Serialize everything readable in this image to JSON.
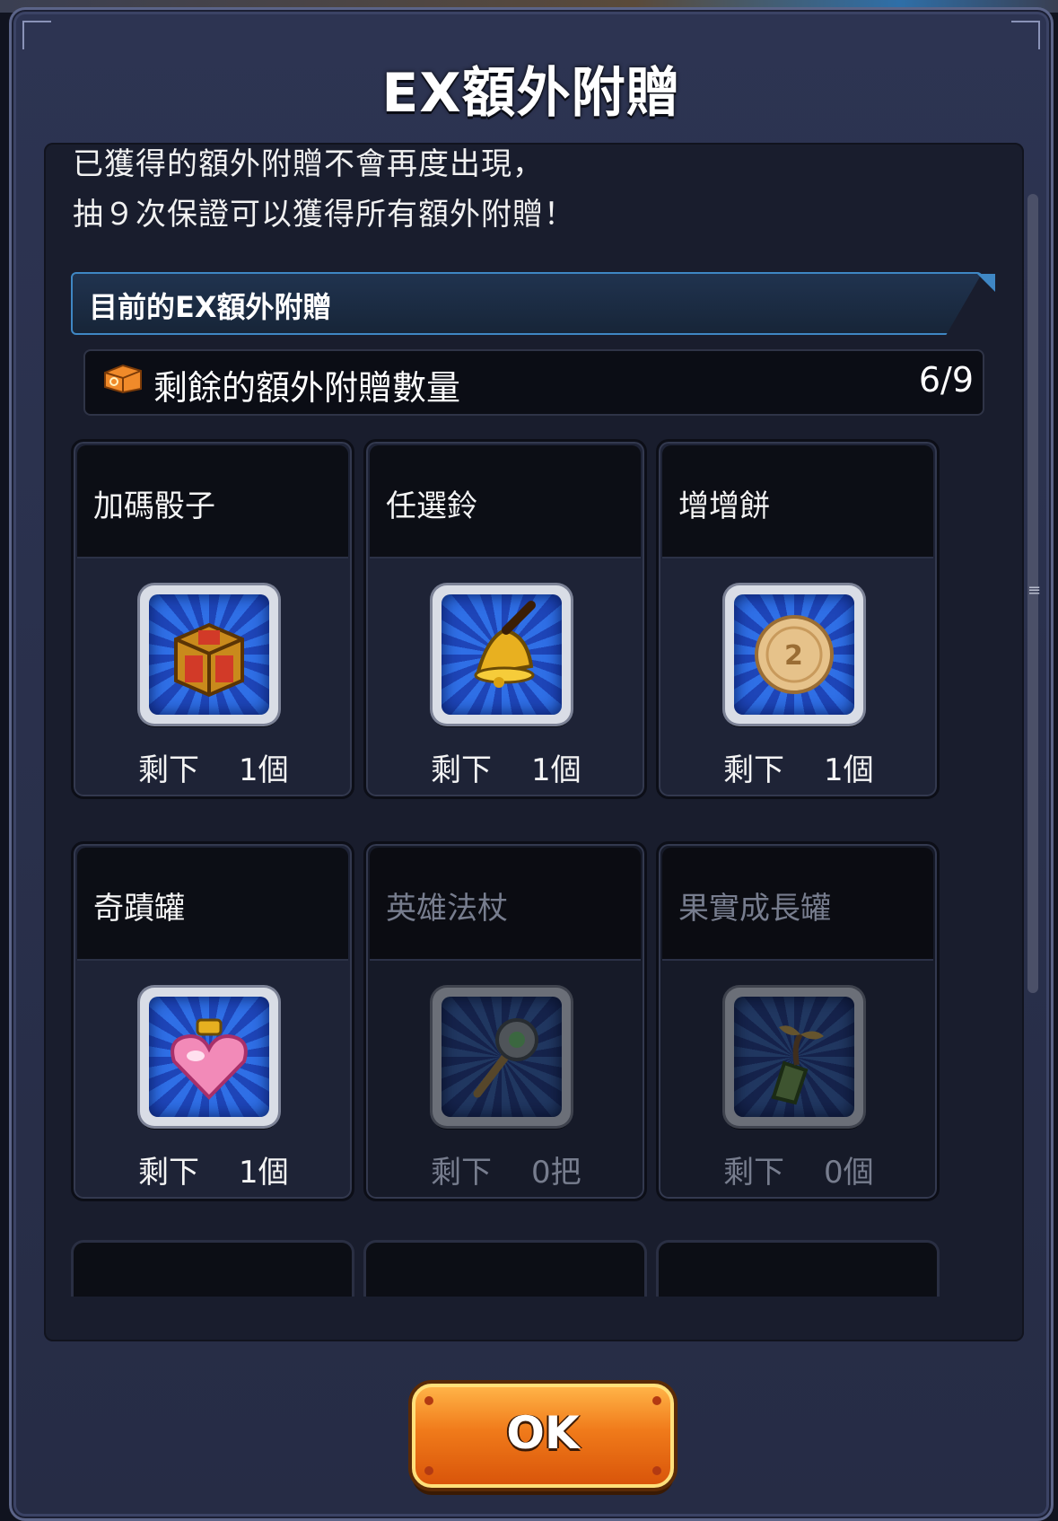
{
  "dialog": {
    "title": "EX額外附贈",
    "description_line1": "已獲得的額外附贈不會再度出現，",
    "description_line2": "抽９次保證可以獲得所有額外附贈！",
    "section_title": "目前的EX額外附贈",
    "remaining_label": "剩餘的額外附贈數量",
    "remaining_count": "6/9"
  },
  "items": [
    {
      "name": "加碼骰子",
      "remain_label": "剩下",
      "count": "1個",
      "icon": "dice-icon",
      "available": true
    },
    {
      "name": "任選鈴",
      "remain_label": "剩下",
      "count": "1個",
      "icon": "bell-icon",
      "available": true
    },
    {
      "name": "增增餅",
      "remain_label": "剩下",
      "count": "1個",
      "icon": "cookie-icon",
      "available": true
    },
    {
      "name": "奇蹟罐",
      "remain_label": "剩下",
      "count": "1個",
      "icon": "heart-jar-icon",
      "available": true
    },
    {
      "name": "英雄法杖",
      "remain_label": "剩下",
      "count": "0把",
      "icon": "staff-icon",
      "available": false
    },
    {
      "name": "果實成長罐",
      "remain_label": "剩下",
      "count": "0個",
      "icon": "sprout-bottle-icon",
      "available": false
    }
  ],
  "buttons": {
    "ok_label": "OK"
  },
  "colors": {
    "accent_blue": "#3f87c4",
    "ok_orange": "#f07a1a",
    "panel_bg": "#262c45"
  }
}
